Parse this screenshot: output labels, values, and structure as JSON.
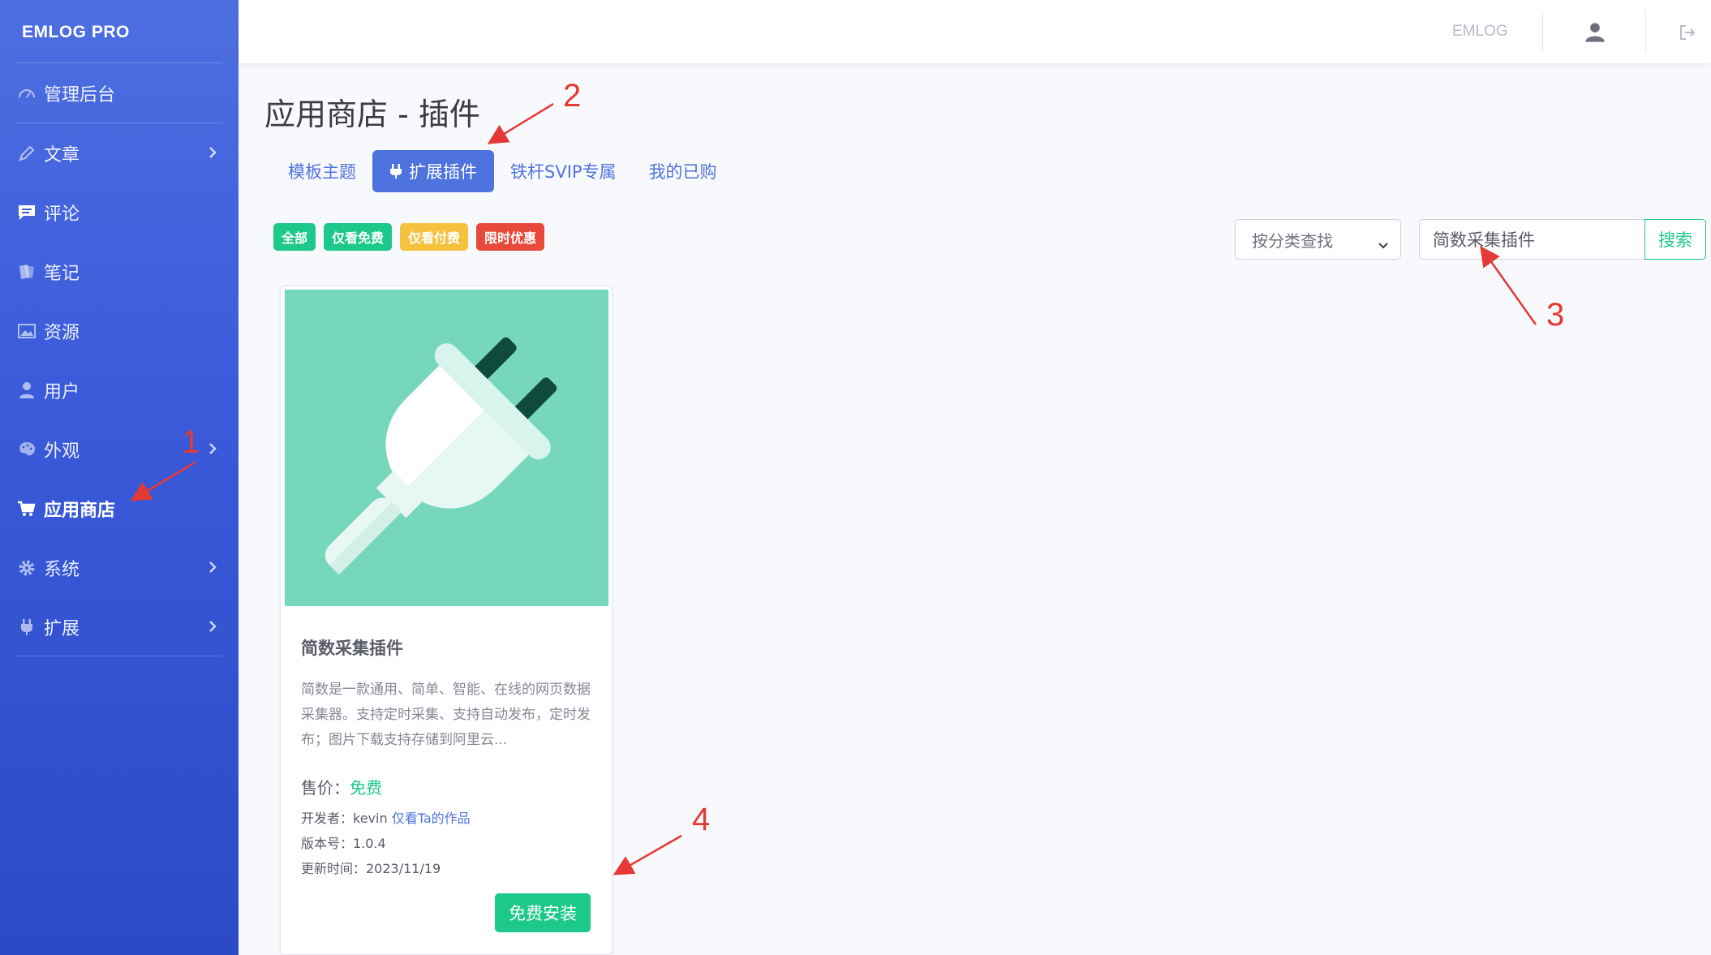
{
  "sidebar": {
    "brand": "EMLOG PRO",
    "items": [
      {
        "label": "管理后台",
        "icon": "dashboard-icon",
        "chevron": false
      },
      {
        "label": "文章",
        "icon": "pencil-icon",
        "chevron": true
      },
      {
        "label": "评论",
        "icon": "comment-icon",
        "chevron": false
      },
      {
        "label": "笔记",
        "icon": "note-icon",
        "chevron": false
      },
      {
        "label": "资源",
        "icon": "image-icon",
        "chevron": false
      },
      {
        "label": "用户",
        "icon": "user-icon",
        "chevron": false
      },
      {
        "label": "外观",
        "icon": "palette-icon",
        "chevron": true
      },
      {
        "label": "应用商店",
        "icon": "cart-icon",
        "chevron": false,
        "active": true
      },
      {
        "label": "系统",
        "icon": "gear-icon",
        "chevron": true
      },
      {
        "label": "扩展",
        "icon": "plug-icon",
        "chevron": true
      }
    ]
  },
  "topbar": {
    "brand": "EMLOG",
    "user_icon": "user-icon",
    "logout_icon": "logout-icon"
  },
  "page": {
    "title": "应用商店 - 插件"
  },
  "tabs": [
    {
      "label": "模板主题",
      "active": false
    },
    {
      "label": "扩展插件",
      "active": true,
      "icon": "plug-icon"
    },
    {
      "label": "铁杆SVIP专属",
      "active": false
    },
    {
      "label": "我的已购",
      "active": false
    }
  ],
  "filters": [
    {
      "label": "全部",
      "color": "#1cc88a"
    },
    {
      "label": "仅看免费",
      "color": "#1cc88a"
    },
    {
      "label": "仅看付费",
      "color": "#f6c23e"
    },
    {
      "label": "限时优惠",
      "color": "#e74a3b"
    }
  ],
  "search": {
    "category_placeholder": "按分类查找",
    "query": "简数采集插件",
    "button_label": "搜索"
  },
  "card": {
    "image_icon": "plug-icon",
    "title": "简数采集插件",
    "description": "简数是一款通用、简单、智能、在线的网页数据采集器。支持定时采集、支持自动发布，定时发布；图片下载支持存储到阿里云...",
    "price_label": "售价：",
    "price_value": "免费",
    "developer_label": "开发者：kevin",
    "developer_link": "仅看Ta的作品",
    "version": "版本号：1.0.4",
    "updated": "更新时间：2023/11/19",
    "install_label": "免费安装"
  },
  "annotations": {
    "n1": "1",
    "n2": "2",
    "n3": "3",
    "n4": "4",
    "color": "#e53935"
  },
  "colors": {
    "primary": "#4e73df",
    "success": "#1cc88a",
    "warning": "#f6c23e",
    "danger": "#e74a3b"
  }
}
